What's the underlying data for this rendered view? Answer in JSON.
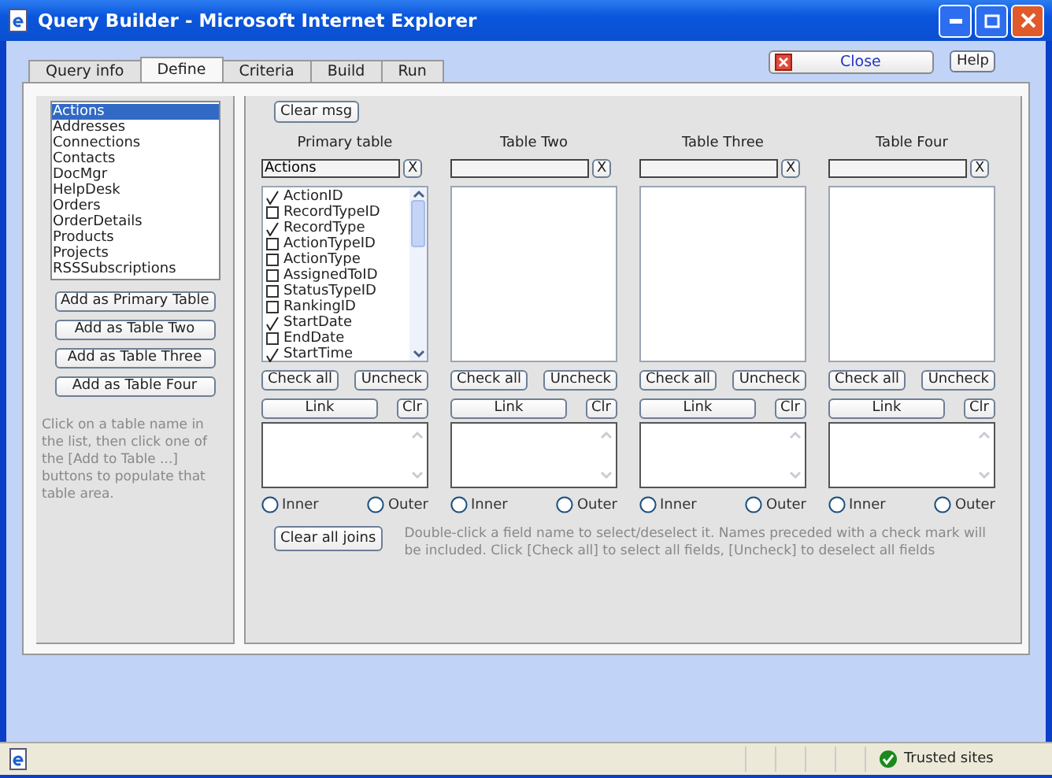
{
  "window": {
    "title": "Query Builder - Microsoft Internet Explorer"
  },
  "tabs": [
    {
      "label": "Query info",
      "selected": false
    },
    {
      "label": "Define",
      "selected": true
    },
    {
      "label": "Criteria",
      "selected": false
    },
    {
      "label": "Build",
      "selected": false
    },
    {
      "label": "Run",
      "selected": false
    }
  ],
  "close_button": "Close",
  "help_button": "Help",
  "table_list": {
    "items": [
      {
        "label": "Actions",
        "selected": true
      },
      {
        "label": "Addresses",
        "selected": false
      },
      {
        "label": "Connections",
        "selected": false
      },
      {
        "label": "Contacts",
        "selected": false
      },
      {
        "label": "DocMgr",
        "selected": false
      },
      {
        "label": "HelpDesk",
        "selected": false
      },
      {
        "label": "Orders",
        "selected": false
      },
      {
        "label": "OrderDetails",
        "selected": false
      },
      {
        "label": "Products",
        "selected": false
      },
      {
        "label": "Projects",
        "selected": false
      },
      {
        "label": "RSSSubscriptions",
        "selected": false
      }
    ]
  },
  "add_buttons": [
    "Add as Primary Table",
    "Add as Table Two",
    "Add as Table Three",
    "Add as Table Four"
  ],
  "left_help": "Click on a table name in the list, then click one of the [Add to Table ...] buttons to populate that table area.",
  "clear_msg_button": "Clear msg",
  "tables": [
    {
      "title": "Primary table",
      "name": "Actions",
      "clear_label": "X",
      "fields": [
        {
          "label": "ActionID",
          "checked": true
        },
        {
          "label": "RecordTypeID",
          "checked": false
        },
        {
          "label": "RecordType",
          "checked": true
        },
        {
          "label": "ActionTypeID",
          "checked": false
        },
        {
          "label": "ActionType",
          "checked": false
        },
        {
          "label": "AssignedToID",
          "checked": false
        },
        {
          "label": "StatusTypeID",
          "checked": false
        },
        {
          "label": "RankingID",
          "checked": false
        },
        {
          "label": "StartDate",
          "checked": true
        },
        {
          "label": "EndDate",
          "checked": false
        },
        {
          "label": "StartTime",
          "checked": true
        }
      ],
      "check_all": "Check all",
      "uncheck": "Uncheck",
      "link": "Link",
      "clr": "Clr",
      "joins": [
        {
          "label": "Inner",
          "selected": false
        },
        {
          "label": "Outer",
          "selected": false
        }
      ]
    },
    {
      "title": "Table Two",
      "clear_label": "X",
      "check_all": "Check all",
      "uncheck": "Uncheck",
      "link": "Link",
      "clr": "Clr",
      "joins": [
        {
          "label": "Inner",
          "selected": false
        },
        {
          "label": "Outer",
          "selected": false
        }
      ]
    },
    {
      "title": "Table Three",
      "clear_label": "X",
      "check_all": "Check all",
      "uncheck": "Uncheck",
      "link": "Link",
      "clr": "Clr",
      "joins": [
        {
          "label": "Inner",
          "selected": false
        },
        {
          "label": "Outer",
          "selected": false
        }
      ]
    },
    {
      "title": "Table Four",
      "clear_label": "X",
      "check_all": "Check all",
      "uncheck": "Uncheck",
      "link": "Link",
      "clr": "Clr",
      "joins": [
        {
          "label": "Inner",
          "selected": false
        },
        {
          "label": "Outer",
          "selected": false
        }
      ]
    }
  ],
  "clear_joins_button": "Clear all joins",
  "help_text": "Double-click a field name to select/deselect it. Names preceded with a check mark will be included. Click [Check all] to select all fields, [Uncheck] to deselect all fields",
  "status_bar": {
    "zone": "Trusted sites"
  }
}
